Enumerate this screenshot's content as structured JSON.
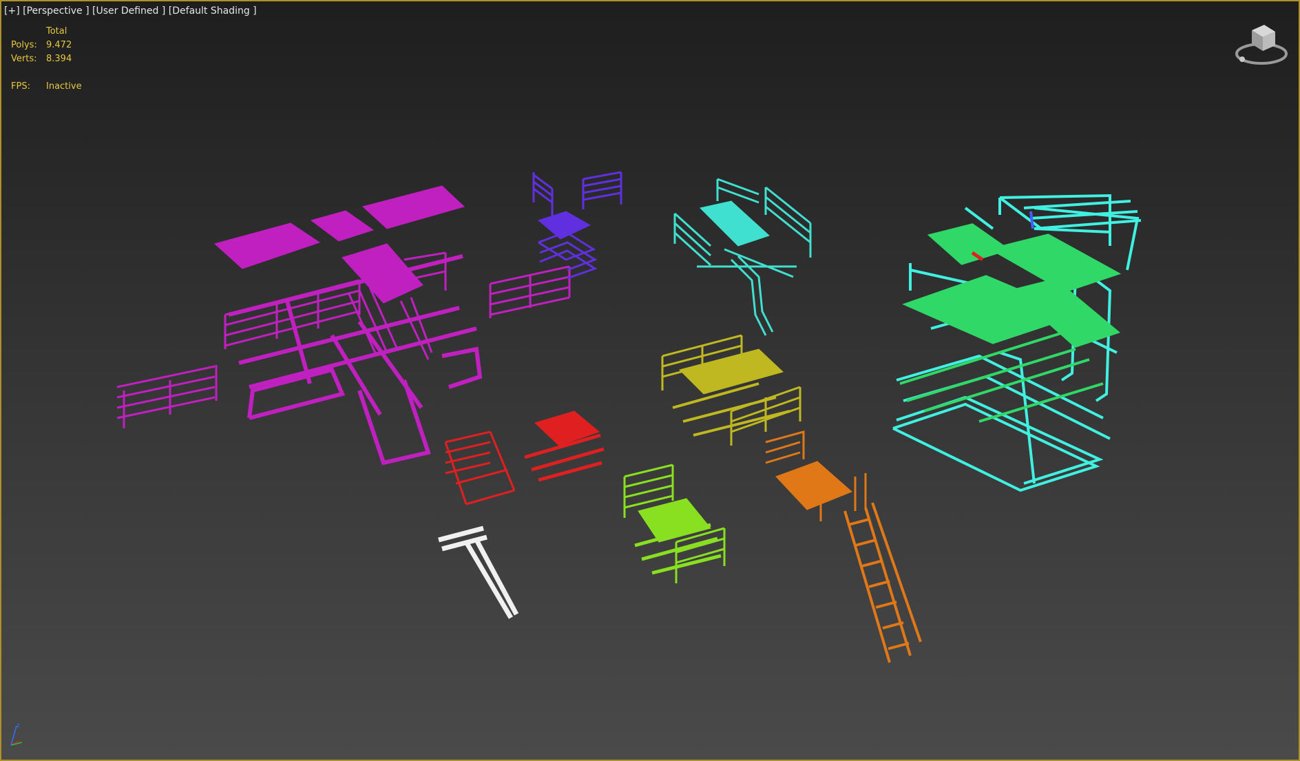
{
  "viewport": {
    "label": "[+] [Perspective ] [User Defined ] [Default Shading ]"
  },
  "stats": {
    "header": "Total",
    "polys_label": "Polys:",
    "polys_value": "9.472",
    "verts_label": "Verts:",
    "verts_value": "8.394",
    "fps_label": "FPS:",
    "fps_value": "Inactive"
  },
  "colors": {
    "frame_border": "#b0902a",
    "stats_text": "#e8c840",
    "magenta": "#c020c0",
    "purple": "#6030e0",
    "cyan": "#40e0d0",
    "aqua": "#40f0e0",
    "green": "#30d868",
    "olive": "#c0b820",
    "red": "#e02020",
    "lime": "#88e020",
    "orange": "#e07818",
    "white": "#f0f0f0"
  },
  "icons": {
    "viewcube": "viewcube-icon",
    "axis": "axis-tripod-icon"
  }
}
